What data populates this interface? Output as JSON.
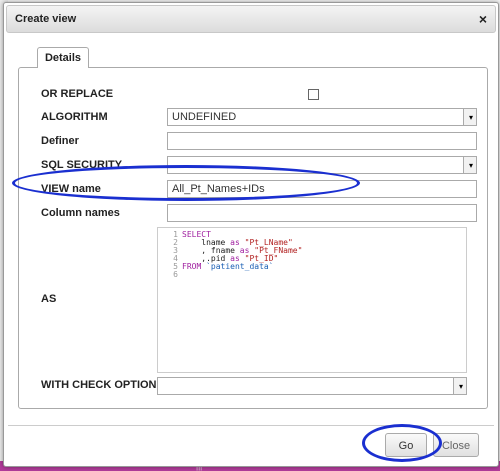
{
  "dialog": {
    "title": "Create view",
    "close_glyph": "×"
  },
  "tabs": [
    {
      "label": "Details"
    }
  ],
  "form": {
    "or_replace": {
      "label": "OR REPLACE",
      "checked": false
    },
    "algorithm": {
      "label": "ALGORITHM",
      "value": "UNDEFINED"
    },
    "definer": {
      "label": "Definer",
      "value": ""
    },
    "sql_security": {
      "label": "SQL SECURITY",
      "value": ""
    },
    "view_name": {
      "label": "VIEW name",
      "value": "All_Pt_Names+IDs"
    },
    "column_names": {
      "label": "Column names",
      "value": ""
    },
    "as": {
      "label": "AS",
      "line_numbers": [
        "1",
        "2",
        "3",
        "4",
        "5",
        "6"
      ],
      "sql_lines": [
        "SELECT",
        "    lname as \"Pt_LName\"",
        "    , fname as \"Pt_FName\"",
        "    ,.pid as \"Pt_ID\"",
        "FROM `patient_data`",
        ""
      ]
    },
    "with_check_option": {
      "label": "WITH CHECK OPTION",
      "value": ""
    }
  },
  "buttons": {
    "go": "Go",
    "close": "Close"
  },
  "colors": {
    "annotation": "#1a2fd0",
    "footer_bar": "#b13b9a"
  }
}
